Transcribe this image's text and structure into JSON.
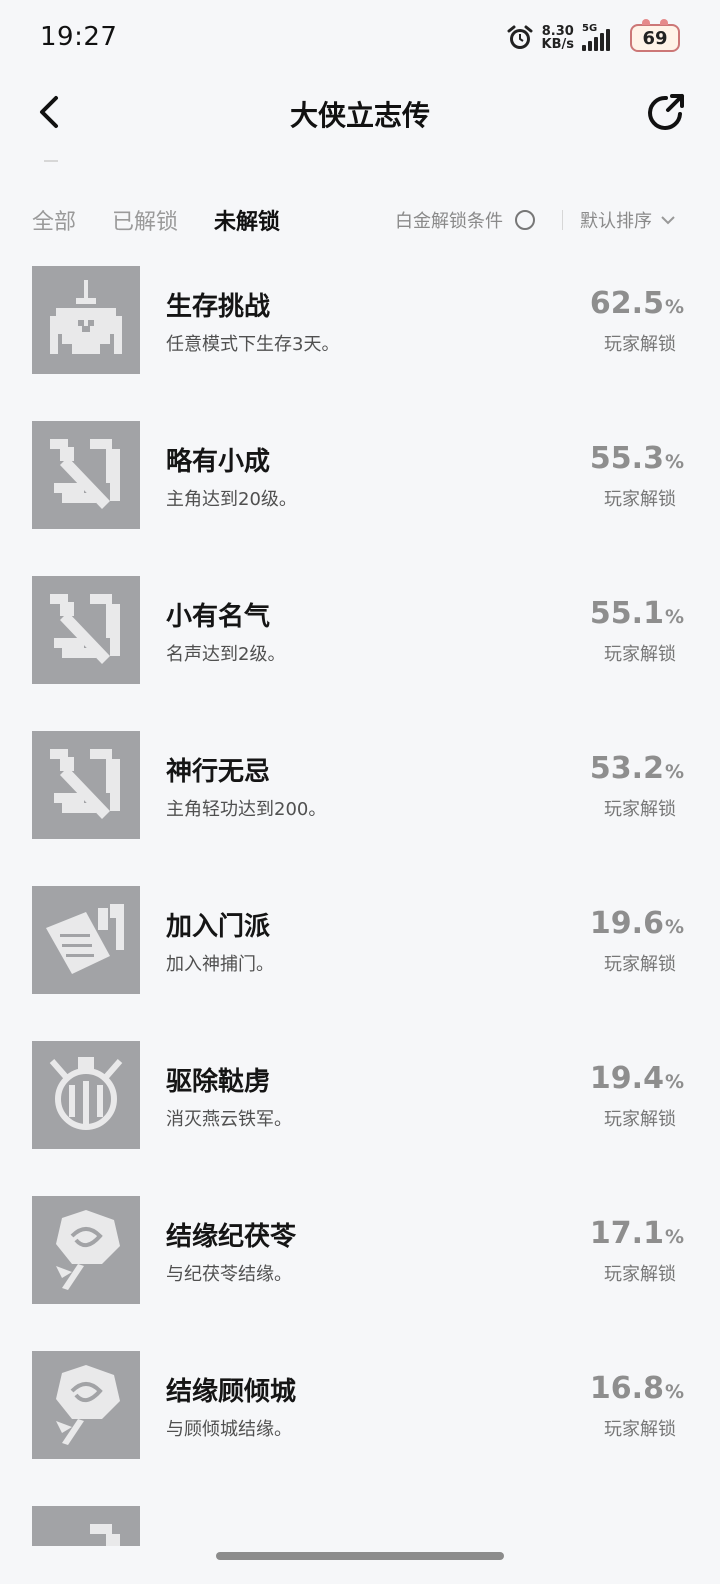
{
  "status_bar": {
    "time": "19:27",
    "net_speed_value": "8.30",
    "net_speed_unit": "KB/s",
    "network": "5G",
    "battery": "69"
  },
  "header": {
    "title": "大侠立志传"
  },
  "filters": {
    "tabs": [
      "全部",
      "已解锁",
      "未解锁"
    ],
    "active_tab": "未解锁",
    "platinum_label": "白金解锁条件",
    "sort_label": "默认排序"
  },
  "achievements": [
    {
      "name": "生存挑战",
      "desc": "任意模式下生存3天。",
      "pct": "62.5",
      "pct_unit": "%",
      "pct_label": "玩家解锁",
      "icon": "campfire-icon"
    },
    {
      "name": "略有小成",
      "desc": "主角达到20级。",
      "pct": "55.3",
      "pct_unit": "%",
      "pct_label": "玩家解锁",
      "icon": "sword-flame-icon"
    },
    {
      "name": "小有名气",
      "desc": "名声达到2级。",
      "pct": "55.1",
      "pct_unit": "%",
      "pct_label": "玩家解锁",
      "icon": "sword-flame-icon"
    },
    {
      "name": "神行无忌",
      "desc": "主角轻功达到200。",
      "pct": "53.2",
      "pct_unit": "%",
      "pct_label": "玩家解锁",
      "icon": "sword-flame-icon"
    },
    {
      "name": "加入门派",
      "desc": "加入神捕门。",
      "pct": "19.6",
      "pct_unit": "%",
      "pct_label": "玩家解锁",
      "icon": "scroll-sword-icon"
    },
    {
      "name": "驱除鞑虏",
      "desc": "消灭燕云铁军。",
      "pct": "19.4",
      "pct_unit": "%",
      "pct_label": "玩家解锁",
      "icon": "shield-emblem-icon"
    },
    {
      "name": "结缘纪茯苓",
      "desc": "与纪茯苓结缘。",
      "pct": "17.1",
      "pct_unit": "%",
      "pct_label": "玩家解锁",
      "icon": "rose-icon"
    },
    {
      "name": "结缘顾倾城",
      "desc": "与顾倾城结缘。",
      "pct": "16.8",
      "pct_unit": "%",
      "pct_label": "玩家解锁",
      "icon": "rose-icon"
    }
  ]
}
